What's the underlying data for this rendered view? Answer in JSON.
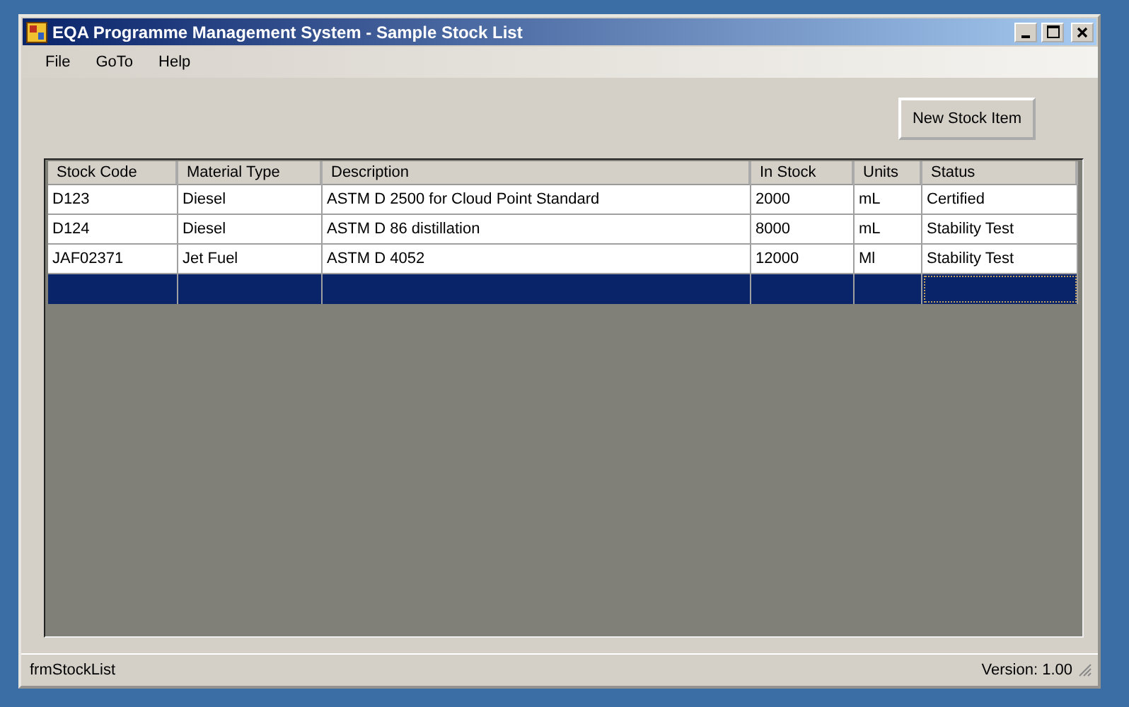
{
  "window": {
    "title": "EQA Programme Management System - Sample Stock List"
  },
  "menu": [
    "File",
    "GoTo",
    "Help"
  ],
  "toolbar": {
    "button": "New Stock Item"
  },
  "table": {
    "columns": [
      "Stock Code",
      "Material Type",
      "Description",
      "In Stock",
      "Units",
      "Status"
    ],
    "rows": [
      {
        "cells": [
          "D123",
          "Diesel",
          "ASTM D 2500 for Cloud Point Standard",
          "2000",
          "mL",
          "Certified"
        ],
        "selected": false
      },
      {
        "cells": [
          "D124",
          "Diesel",
          "ASTM D 86 distillation",
          "8000",
          "mL",
          "Stability Test"
        ],
        "selected": false
      },
      {
        "cells": [
          "JAF02371",
          "Jet Fuel",
          "ASTM D 4052",
          "12000",
          "Ml",
          "Stability Test"
        ],
        "selected": false
      }
    ],
    "new_row": {
      "selected": true
    }
  },
  "status_bar": {
    "left": "frmStockList",
    "right": "Version: 1.00"
  }
}
